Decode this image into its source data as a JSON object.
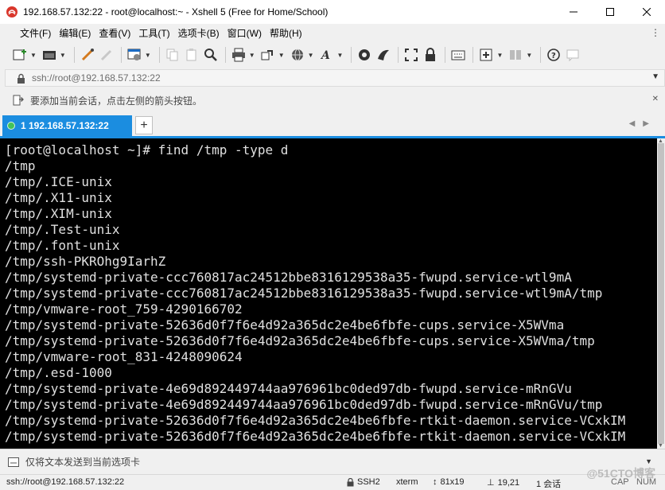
{
  "window": {
    "title": "192.168.57.132:22 - root@localhost:~ - Xshell 5 (Free for Home/School)"
  },
  "menu": {
    "items": [
      "文件(F)",
      "编辑(E)",
      "查看(V)",
      "工具(T)",
      "选项卡(B)",
      "窗口(W)",
      "帮助(H)"
    ]
  },
  "address": {
    "value": "ssh://root@192.168.57.132:22"
  },
  "hint": {
    "text": "要添加当前会话，点击左侧的箭头按钮。"
  },
  "tab": {
    "label": "1 192.168.57.132:22",
    "new_label": "+"
  },
  "terminal": {
    "lines": [
      "[root@localhost ~]# find /tmp -type d",
      "/tmp",
      "/tmp/.ICE-unix",
      "/tmp/.X11-unix",
      "/tmp/.XIM-unix",
      "/tmp/.Test-unix",
      "/tmp/.font-unix",
      "/tmp/ssh-PKROhg9IarhZ",
      "/tmp/systemd-private-ccc760817ac24512bbe8316129538a35-fwupd.service-wtl9mA",
      "/tmp/systemd-private-ccc760817ac24512bbe8316129538a35-fwupd.service-wtl9mA/tmp",
      "/tmp/vmware-root_759-4290166702",
      "/tmp/systemd-private-52636d0f7f6e4d92a365dc2e4be6fbfe-cups.service-X5WVma",
      "/tmp/systemd-private-52636d0f7f6e4d92a365dc2e4be6fbfe-cups.service-X5WVma/tmp",
      "/tmp/vmware-root_831-4248090624",
      "/tmp/.esd-1000",
      "/tmp/systemd-private-4e69d892449744aa976961bc0ded97db-fwupd.service-mRnGVu",
      "/tmp/systemd-private-4e69d892449744aa976961bc0ded97db-fwupd.service-mRnGVu/tmp",
      "/tmp/systemd-private-52636d0f7f6e4d92a365dc2e4be6fbfe-rtkit-daemon.service-VCxkIM",
      "/tmp/systemd-private-52636d0f7f6e4d92a365dc2e4be6fbfe-rtkit-daemon.service-VCxkIM"
    ]
  },
  "compose": {
    "placeholder": "仅将文本发送到当前选项卡"
  },
  "status": {
    "connection": "ssh://root@192.168.57.132:22",
    "protocol": "SSH2",
    "terminal_type": "xterm",
    "size": "81x19",
    "cursor": "19,21",
    "sessions": "1 会话",
    "caps": "CAP",
    "num": "NUM"
  },
  "watermark": "@51CTO博客",
  "colors": {
    "accent": "#1b8de0",
    "terminal_bg": "#000000",
    "terminal_fg": "#e0e0e0"
  }
}
